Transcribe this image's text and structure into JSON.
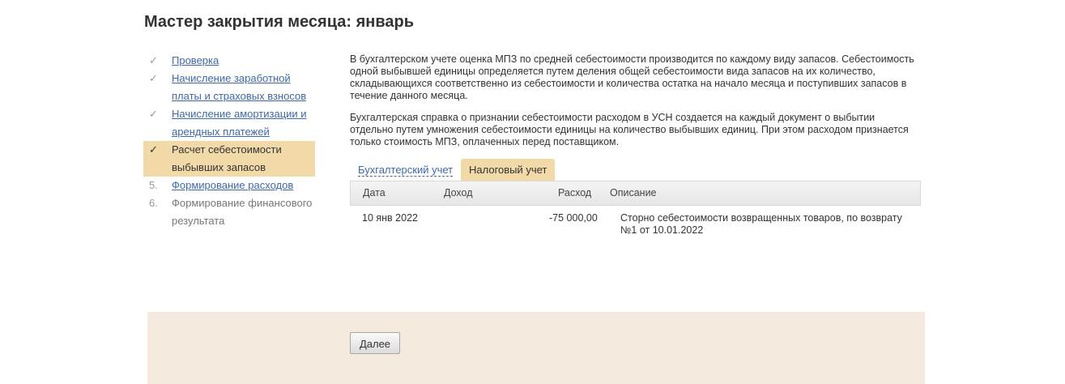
{
  "page": {
    "title": "Мастер закрытия месяца: январь"
  },
  "steps": [
    {
      "marker": "✓",
      "label": "Проверка",
      "state": "done"
    },
    {
      "marker": "✓",
      "label_line1": "Начисление заработной",
      "label_line2": "платы и страховых взносов",
      "state": "done"
    },
    {
      "marker": "✓",
      "label_line1": "Начисление амортизации и",
      "label_line2": "арендных платежей",
      "state": "done"
    },
    {
      "marker": "✓",
      "label_line1": "Расчет себестоимости",
      "label_line2": "выбывших запасов",
      "state": "active"
    },
    {
      "marker": "5.",
      "label": "Формирование расходов",
      "state": "link"
    },
    {
      "marker": "6.",
      "label_line1": "Формирование финансового",
      "label_line2": "результата",
      "state": "pending"
    }
  ],
  "content": {
    "paragraph1": "В бухгалтерском учете оценка МПЗ по средней себестоимости производится по каждому виду запасов. Себестоимость одной выбывшей единицы определяется путем деления общей себестоимости вида запасов на их количество, складывающихся соответственно из себестоимости и количества остатка на начало месяца и поступивших запасов в течение данного месяца.",
    "paragraph2": "Бухгалтерская справка о признании себестоимости расходом в УСН создается на каждый документ о выбытии отдельно путем умножения себестоимости единицы на количество выбывших единиц. При этом расходом признается только стоимость МПЗ, оплаченных перед поставщиком."
  },
  "tabs": [
    {
      "label": "Бухгалтерский учет",
      "active": false
    },
    {
      "label": "Налоговый учет",
      "active": true
    }
  ],
  "table": {
    "columns": [
      "Дата",
      "Доход",
      "Расход",
      "Описание"
    ],
    "rows": [
      {
        "date": "10 янв 2022",
        "income": "",
        "expense": "-75 000,00",
        "description_line1": "Сторно себестоимости возвращенных товаров, по возврату",
        "description_line2": "№1 от 10.01.2022"
      }
    ]
  },
  "footer": {
    "next_label": "Далее"
  },
  "colors": {
    "accent": "#f2d9a8",
    "link": "#3d69a8",
    "footer_bg": "#f3eadd"
  }
}
